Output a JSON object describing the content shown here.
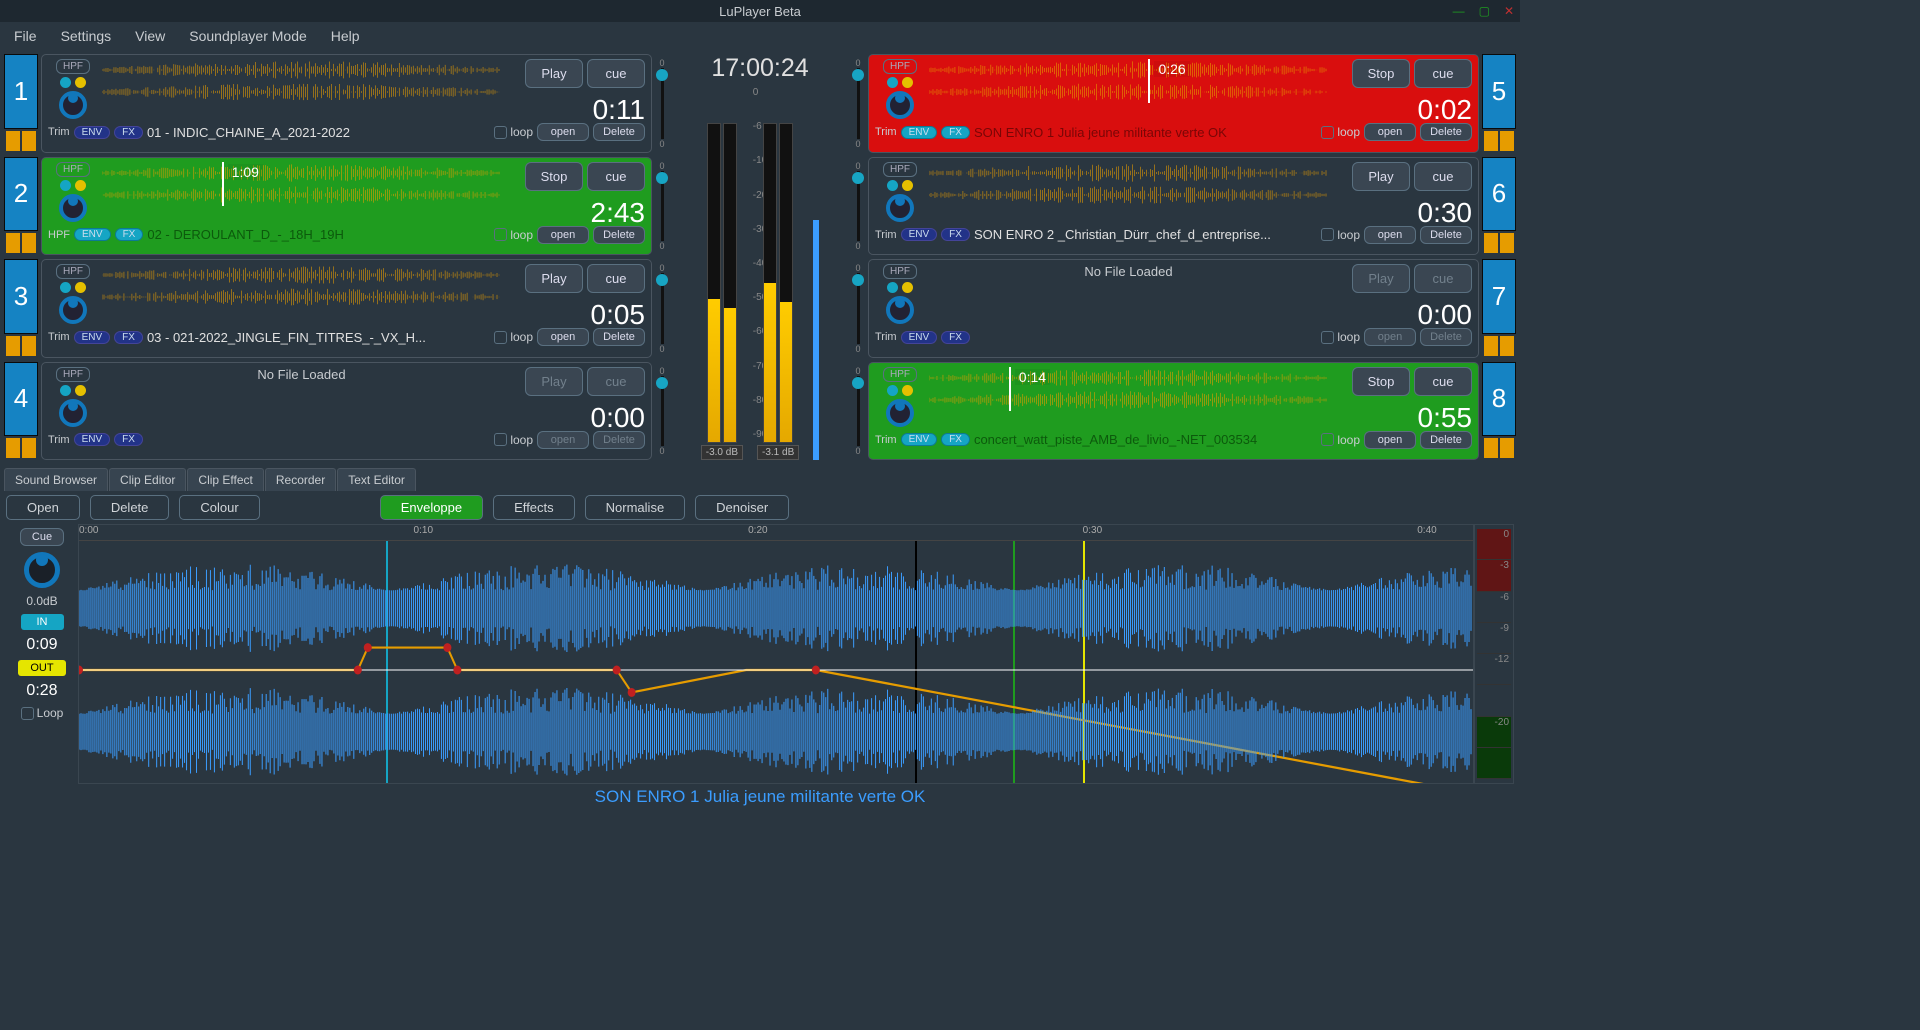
{
  "window": {
    "title": "LuPlayer Beta"
  },
  "menubar": [
    "File",
    "Settings",
    "View",
    "Soundplayer Mode",
    "Help"
  ],
  "clock": "17:00:24",
  "meters": {
    "left_db": "-3.0 dB",
    "right_db": "-3.1 dB",
    "scale": [
      "0",
      "-6",
      "-10",
      "-20",
      "-30",
      "-40",
      "-50",
      "-60",
      "-70",
      "-80",
      "-90"
    ]
  },
  "players": [
    {
      "num": "1",
      "state": "idle",
      "hpf": "HPF",
      "play": "Play",
      "cue": "cue",
      "time": "0:11",
      "filename": "01 - INDIC_CHAINE_A_2021-2022",
      "loop": false,
      "open": "open",
      "delete": "Delete",
      "trim": "Trim",
      "env": "ENV",
      "fx": "FX",
      "nofile": false,
      "playhead": null
    },
    {
      "num": "2",
      "state": "green",
      "hpf": "HPF",
      "play": "Stop",
      "cue": "cue",
      "time": "2:43",
      "filename": "02 - DEROULANT_D_-_18H_19H",
      "loop": true,
      "open": "open",
      "delete": "Delete",
      "trim": "HPF",
      "env": "ENV",
      "fx": "FX",
      "nofile": false,
      "playhead": "30%",
      "ptime": "1:09"
    },
    {
      "num": "3",
      "state": "idle",
      "hpf": "HPF",
      "play": "Play",
      "cue": "cue",
      "time": "0:05",
      "filename": "03 - 021-2022_JINGLE_FIN_TITRES_-_VX_H...",
      "loop": false,
      "open": "open",
      "delete": "Delete",
      "trim": "Trim",
      "env": "ENV",
      "fx": "FX",
      "nofile": false,
      "playhead": null
    },
    {
      "num": "4",
      "state": "idle",
      "hpf": "HPF",
      "play": "Play",
      "cue": "cue",
      "time": "0:00",
      "filename": "",
      "loop": false,
      "open": "open",
      "delete": "Delete",
      "trim": "Trim",
      "env": "ENV",
      "fx": "FX",
      "nofile": true,
      "nofile_text": "No File Loaded",
      "playhead": null,
      "dim": true
    },
    {
      "num": "5",
      "state": "red",
      "hpf": "HPF",
      "play": "Stop",
      "cue": "cue",
      "time": "0:02",
      "filename": "SON ENRO 1 Julia  jeune militante verte OK",
      "loop": false,
      "open": "open",
      "delete": "Delete",
      "trim": "Trim",
      "env": "ENV",
      "fx": "FX",
      "nofile": false,
      "playhead": "55%",
      "ptime": "0:26"
    },
    {
      "num": "6",
      "state": "idle",
      "hpf": "HPF",
      "play": "Play",
      "cue": "cue",
      "time": "0:30",
      "filename": "SON ENRO 2 _Christian_Dürr_chef_d_entreprise...",
      "loop": false,
      "open": "open",
      "delete": "Delete",
      "trim": "Trim",
      "env": "ENV",
      "fx": "FX",
      "nofile": false,
      "playhead": null
    },
    {
      "num": "7",
      "state": "idle",
      "hpf": "HPF",
      "play": "Play",
      "cue": "cue",
      "time": "0:00",
      "filename": "",
      "loop": false,
      "open": "open",
      "delete": "Delete",
      "trim": "Trim",
      "env": "ENV",
      "fx": "FX",
      "nofile": true,
      "nofile_text": "No File Loaded",
      "playhead": null,
      "dim": true
    },
    {
      "num": "8",
      "state": "green",
      "hpf": "HPF",
      "play": "Stop",
      "cue": "cue",
      "time": "0:55",
      "filename": "concert_watt_piste_AMB_de_livio_-NET_003534",
      "loop": false,
      "open": "open",
      "delete": "Delete",
      "trim": "Trim",
      "env": "ENV",
      "fx": "FX",
      "nofile": false,
      "playhead": "20%",
      "ptime": "0:14"
    }
  ],
  "tabs": [
    "Sound Browser",
    "Clip Editor",
    "Clip Effect",
    "Recorder",
    "Text Editor"
  ],
  "editor": {
    "buttons": [
      "Open",
      "Delete",
      "Colour"
    ],
    "buttons2": [
      "Enveloppe",
      "Effects",
      "Normalise",
      "Denoiser"
    ],
    "cue": "Cue",
    "gain": "0.0dB",
    "in": "IN",
    "in_time": "0:09",
    "out": "OUT",
    "out_time": "0:28",
    "loop": "Loop",
    "ruler": [
      "0:00",
      "0:10",
      "0:20",
      "0:30",
      "0:40"
    ],
    "right_scale": [
      "0",
      "-3",
      "-6",
      "-9",
      "-12",
      "",
      "-20",
      ""
    ],
    "footer": "SON ENRO 1 Julia  jeune militante verte OK"
  }
}
